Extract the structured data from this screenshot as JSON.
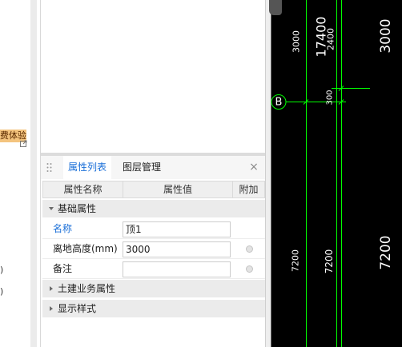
{
  "left_panel": {
    "badge": "费体验",
    "badge_icon": "external-link-icon",
    "fragments": [
      ")",
      ")"
    ]
  },
  "property_panel": {
    "drag_icon": "drag-handle-icon",
    "tabs": [
      {
        "label": "属性列表",
        "active": true
      },
      {
        "label": "图层管理",
        "active": false
      }
    ],
    "close_label": "×",
    "columns": {
      "name": "属性名称",
      "value": "属性值",
      "attach": "附加"
    },
    "groups": [
      {
        "label": "基础属性",
        "expanded": true,
        "rows": [
          {
            "name": "名称",
            "value": "顶1",
            "attach": false
          },
          {
            "name": "离地高度(mm)",
            "value": "3000",
            "attach": true
          },
          {
            "name": "备注",
            "value": "",
            "attach": true
          }
        ]
      },
      {
        "label": "土建业务属性",
        "expanded": false
      },
      {
        "label": "显示样式",
        "expanded": false
      }
    ]
  },
  "canvas": {
    "axis_label": "B",
    "dimensions": [
      "17400",
      "2400",
      "3000",
      "3000",
      "300",
      "7200",
      "7200",
      "7200"
    ]
  },
  "colors": {
    "accent": "#1a6fd8",
    "badge": "#f4c47e",
    "canvas_background": "#000000",
    "canvas_line": "#00ff00",
    "canvas_text": "#ffffff"
  }
}
